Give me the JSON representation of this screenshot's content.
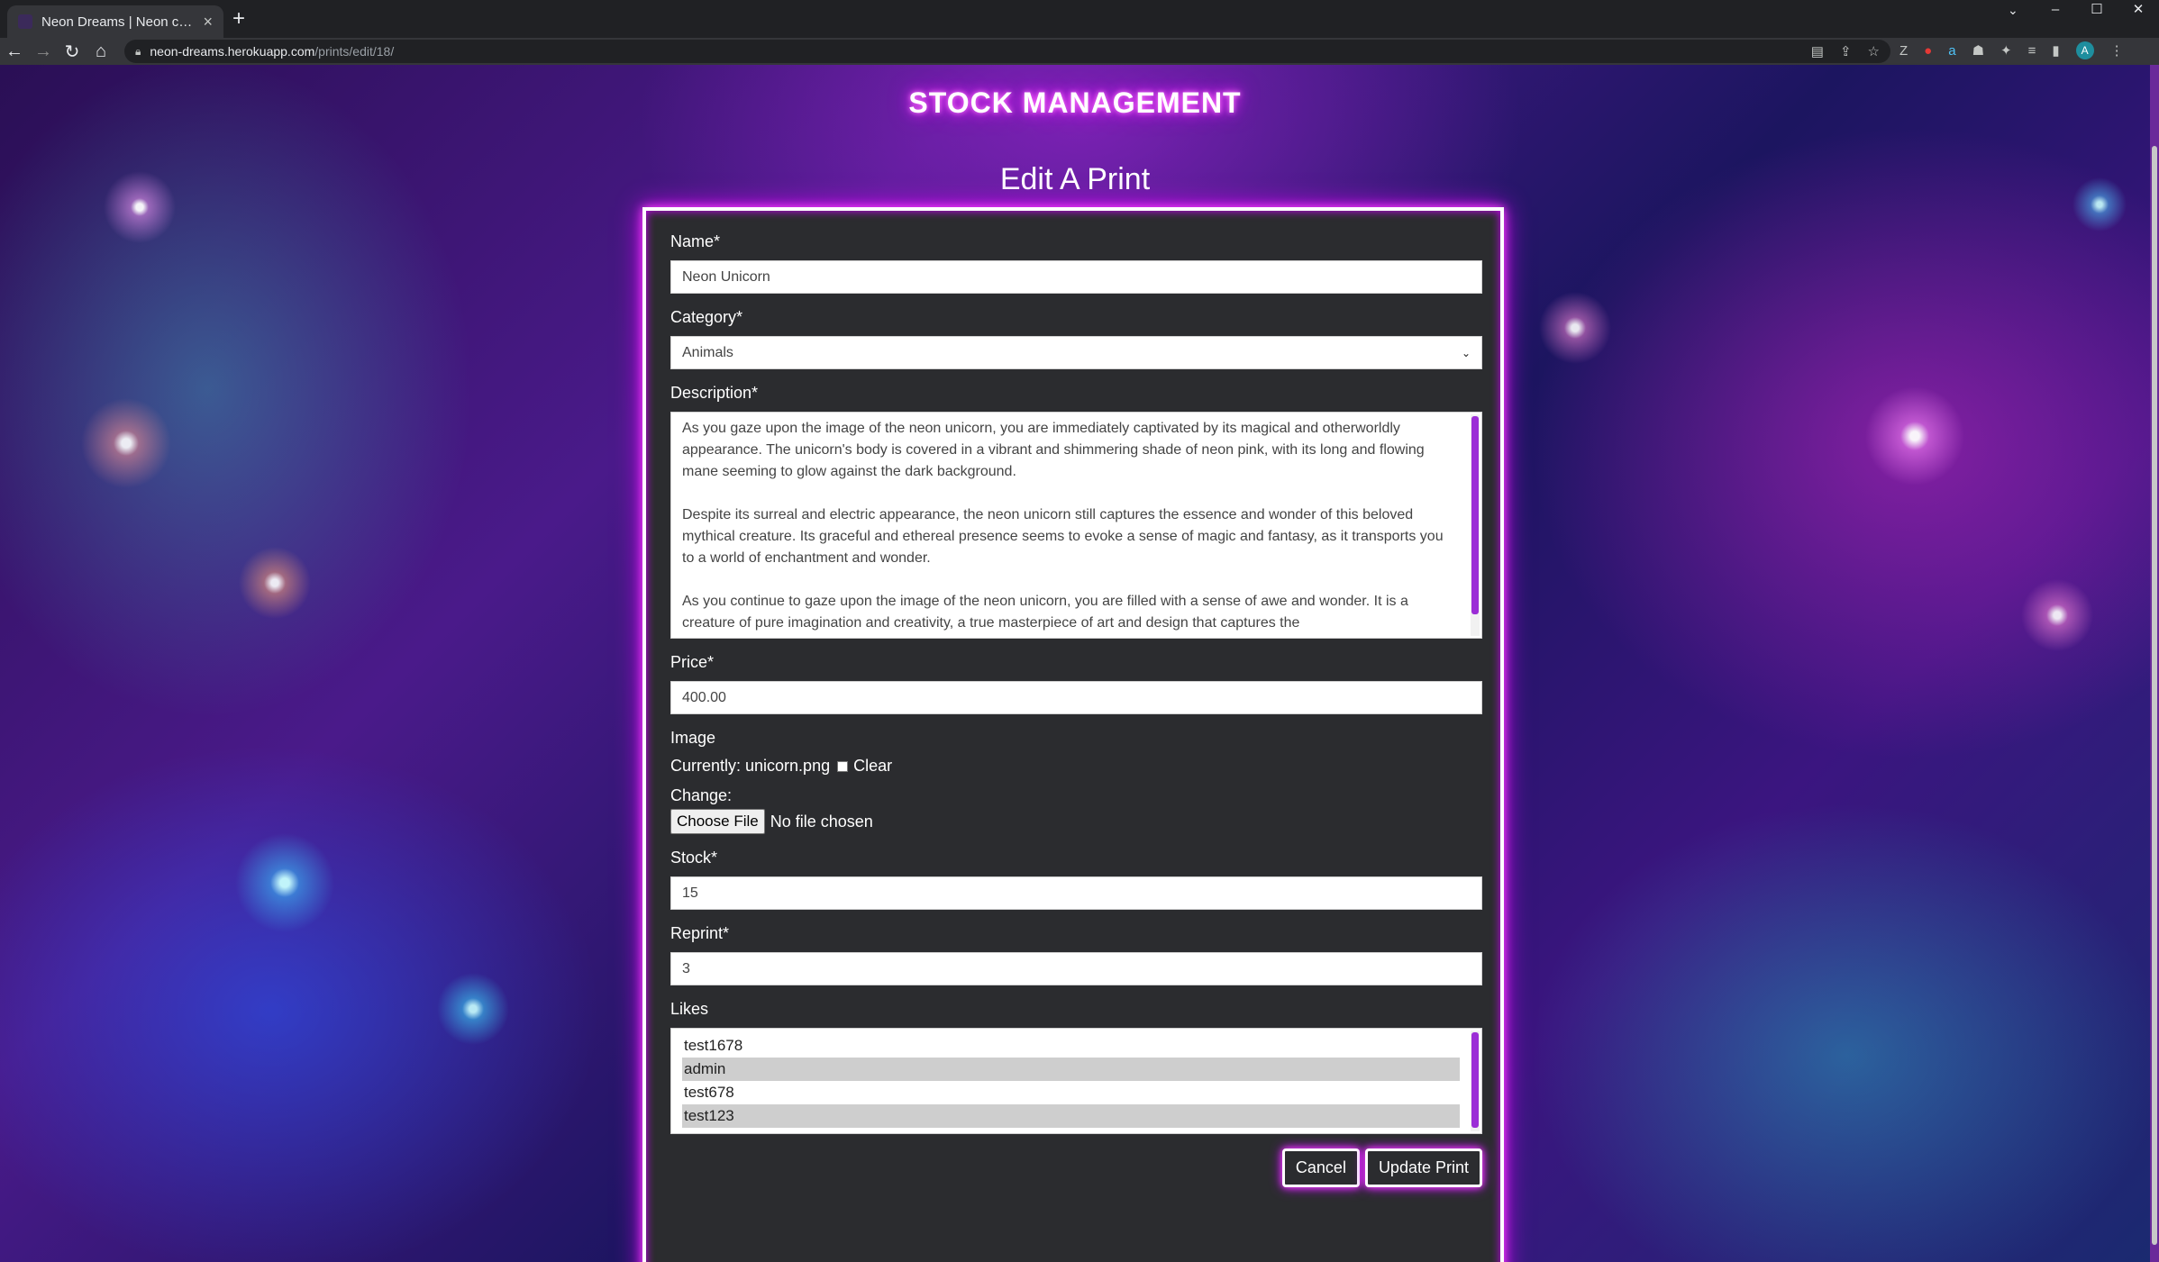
{
  "browser": {
    "tab_title": "Neon Dreams | Neon canvas pri",
    "url_host": "neon-dreams.herokuapp.com",
    "url_path": "/prints/edit/18/",
    "profile_initial": "A"
  },
  "page": {
    "heading": "STOCK MANAGEMENT",
    "form_title": "Edit A Print"
  },
  "form": {
    "name_label": "Name*",
    "name_value": "Neon Unicorn",
    "category_label": "Category*",
    "category_value": "Animals",
    "description_label": "Description*",
    "description_paragraphs": [
      "As you gaze upon the image of the neon unicorn, you are immediately captivated by its magical and otherworldly appearance. The unicorn's body is covered in a vibrant and shimmering shade of neon pink, with its long and flowing mane seeming to glow against the dark background.",
      "Despite its surreal and electric appearance, the neon unicorn still captures the essence and wonder of this beloved mythical creature. Its graceful and ethereal presence seems to evoke a sense of magic and fantasy, as it transports you to a world of enchantment and wonder.",
      "As you continue to gaze upon the image of the neon unicorn, you are filled with a sense of awe and wonder. It is a creature of pure imagination and creativity, a true masterpiece of art and design that captures the"
    ],
    "price_label": "Price*",
    "price_value": "400.00",
    "image_label": "Image",
    "image_currently": "Currently: unicorn.png",
    "image_clear": "Clear",
    "image_change_label": "Change:",
    "file_button": "Choose File",
    "file_status": "No file chosen",
    "stock_label": "Stock*",
    "stock_value": "15",
    "reprint_label": "Reprint*",
    "reprint_value": "3",
    "likes_label": "Likes",
    "likes_options": [
      "test1678",
      "admin",
      "test678",
      "test123"
    ],
    "cancel_button": "Cancel",
    "update_button": "Update Print"
  },
  "colors": {
    "neon_pink": "#ff4cff",
    "neon_purple": "#c000ff",
    "card_bg": "#2b2c2f",
    "scroll_accent": "#9b2dd6"
  },
  "icons": [
    "back-icon",
    "forward-icon",
    "reload-icon",
    "home-icon",
    "lock-icon",
    "star-icon",
    "share-icon",
    "extensions-icon",
    "menu-icon"
  ]
}
